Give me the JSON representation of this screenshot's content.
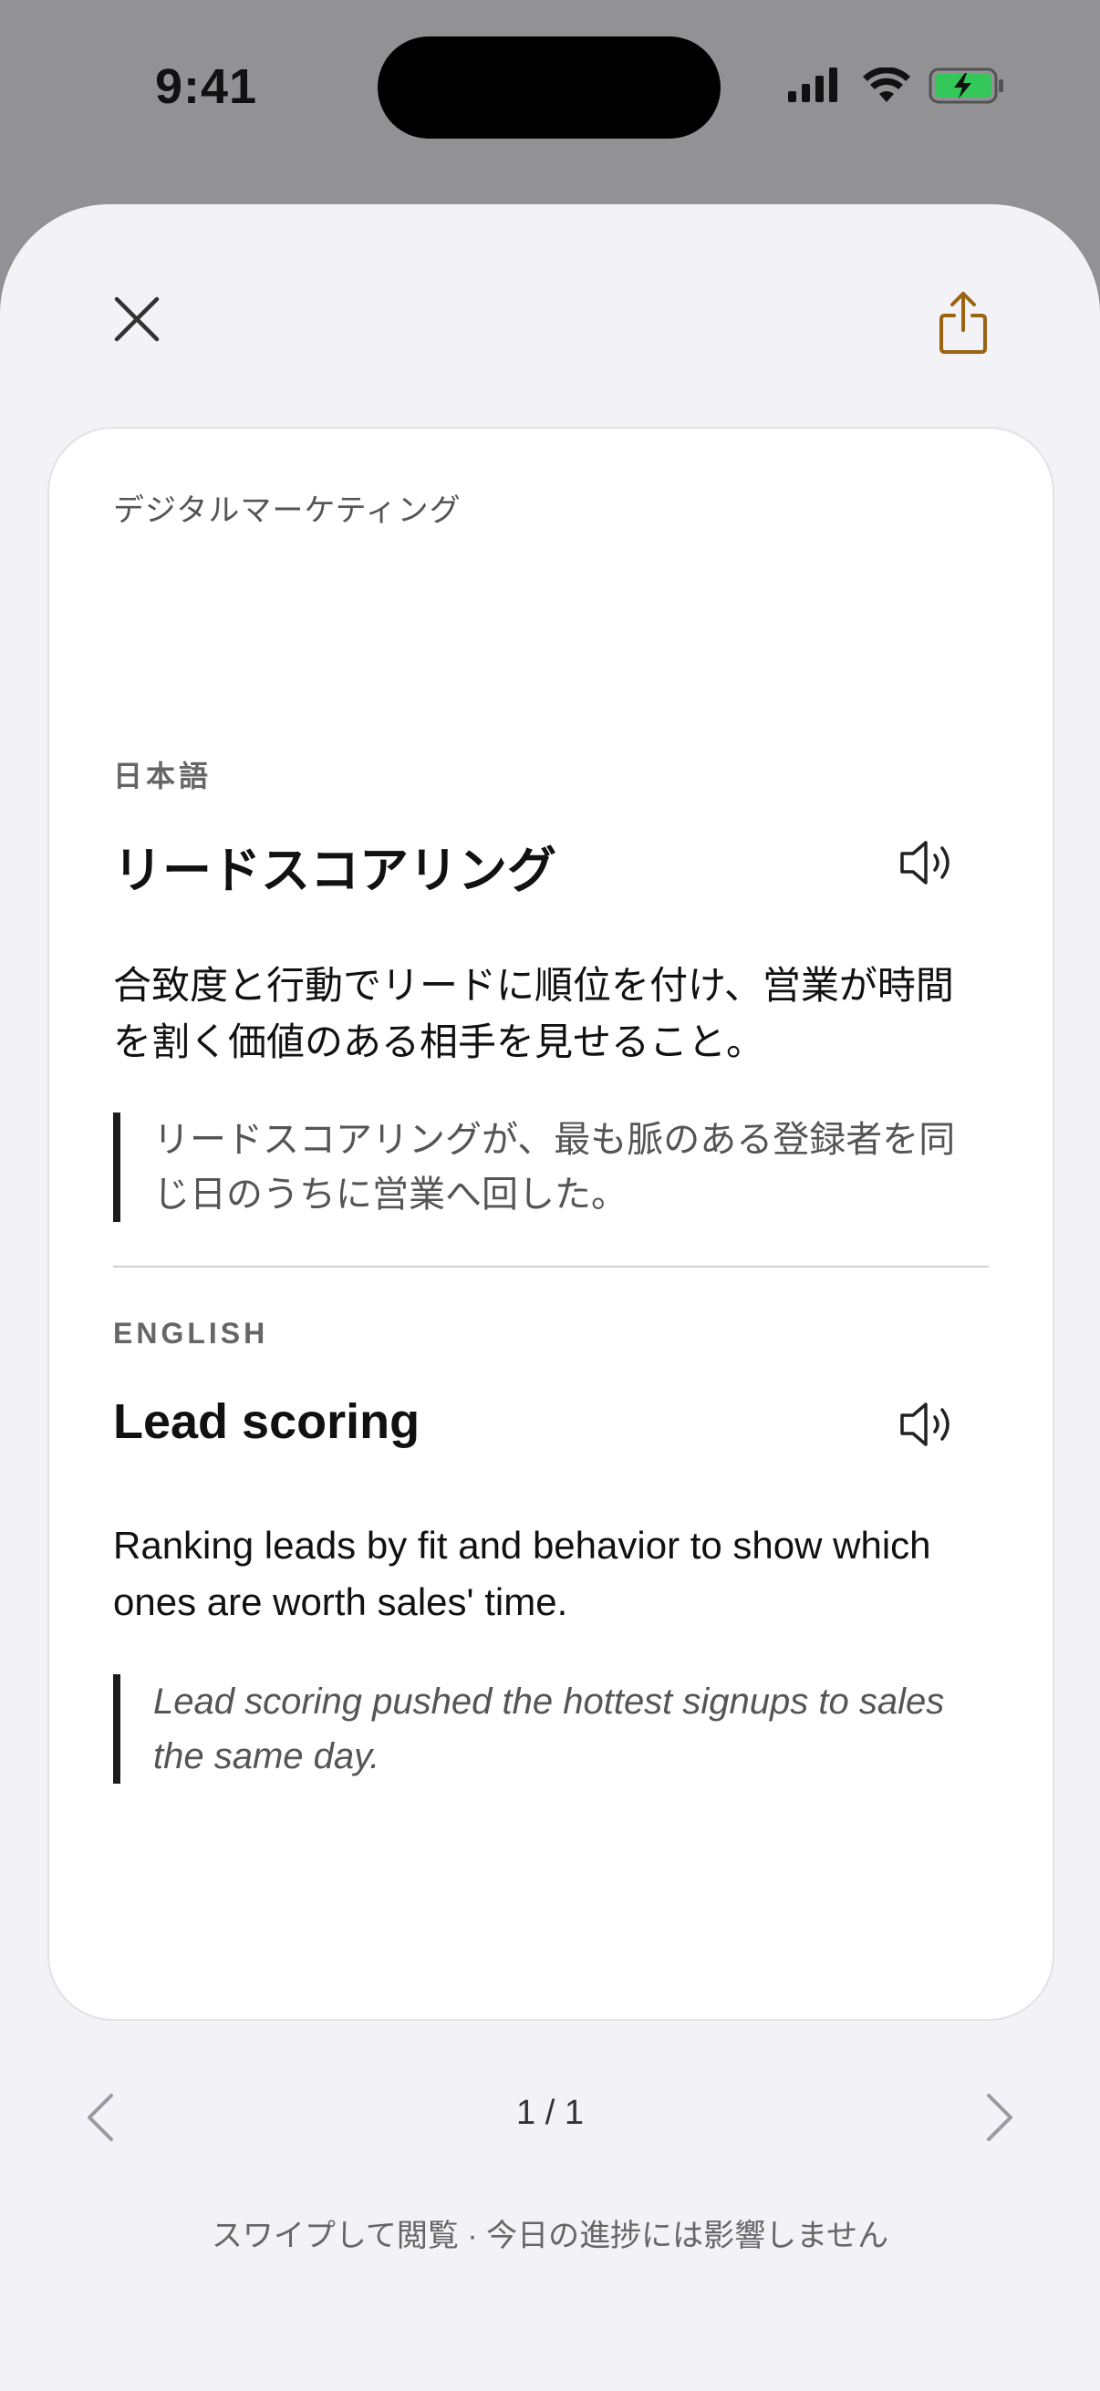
{
  "status_bar": {
    "time": "9:41",
    "icons": [
      "cellular-signal-icon",
      "wifi-icon",
      "battery-charging-icon"
    ],
    "battery_color": "#34c759"
  },
  "header": {
    "close_icon": "close-icon",
    "share_icon": "share-icon",
    "accent_color": "#9a6412"
  },
  "card": {
    "category": "デジタルマーケティング",
    "japanese": {
      "label": "日本語",
      "term": "リードスコアリング",
      "definition": "合致度と行動でリードに順位を付け、営業が時間を割く価値のある相手を見せること。",
      "example": "リードスコアリングが、最も脈のある登録者を同じ日のうちに営業へ回した。"
    },
    "english": {
      "label": "ENGLISH",
      "term": "Lead scoring",
      "definition": "Ranking leads by fit and behavior to show which ones are worth sales' time.",
      "example": "Lead scoring pushed the hottest signups to sales the same day."
    }
  },
  "pagination": {
    "indicator": "1 / 1",
    "prev_icon": "chevron-left-icon",
    "next_icon": "chevron-right-icon"
  },
  "footer": {
    "note": "スワイプして閲覧 · 今日の進捗には影響しません"
  }
}
